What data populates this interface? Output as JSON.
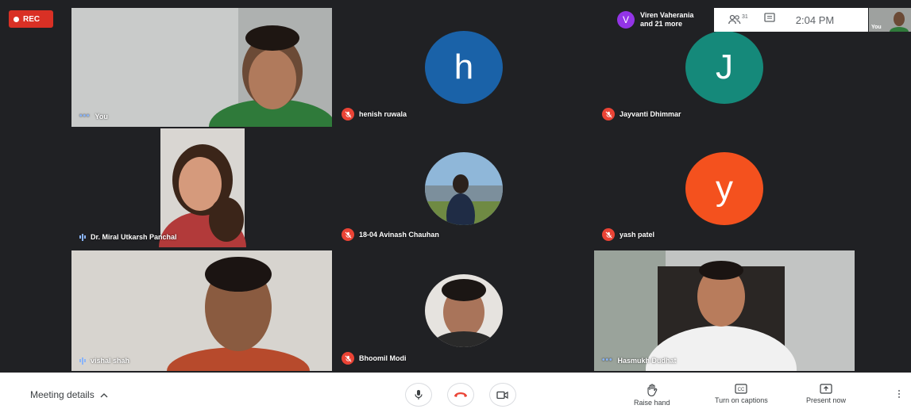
{
  "recording": {
    "label": "REC"
  },
  "participants_banner": {
    "initial": "V",
    "line1": "Viren Vaherania",
    "line2": "and 21 more"
  },
  "top_controls": {
    "people_count": "31",
    "time": "2:04 PM",
    "self_label": "You"
  },
  "tiles": [
    {
      "name": "You",
      "indicator": "speaking-dots"
    },
    {
      "name": "henish ruwala",
      "indicator": "muted",
      "avatar_letter": "h",
      "avatar_color": "#1a62a8"
    },
    {
      "name": "Jayvanti Dhimmar",
      "indicator": "muted",
      "avatar_letter": "J",
      "avatar_color": "#15897a"
    },
    {
      "name": "Dr. Miral Utkarsh Panchal",
      "indicator": "audio-bars"
    },
    {
      "name": "18-04 Avinash Chauhan",
      "indicator": "muted"
    },
    {
      "name": "yash patel",
      "indicator": "muted",
      "avatar_letter": "y",
      "avatar_color": "#f4511e"
    },
    {
      "name": "vishal shah",
      "indicator": "audio-bars"
    },
    {
      "name": "Bhoomil Modi",
      "indicator": "muted"
    },
    {
      "name": "Hasmukh Dudhat",
      "indicator": "speaking-dots"
    }
  ],
  "bottom_bar": {
    "meeting_details": "Meeting details",
    "raise_hand": "Raise hand",
    "captions": "Turn on captions",
    "present": "Present now"
  },
  "colors": {
    "accent": "#1a73e8",
    "danger": "#ea4335",
    "background": "#202124"
  }
}
